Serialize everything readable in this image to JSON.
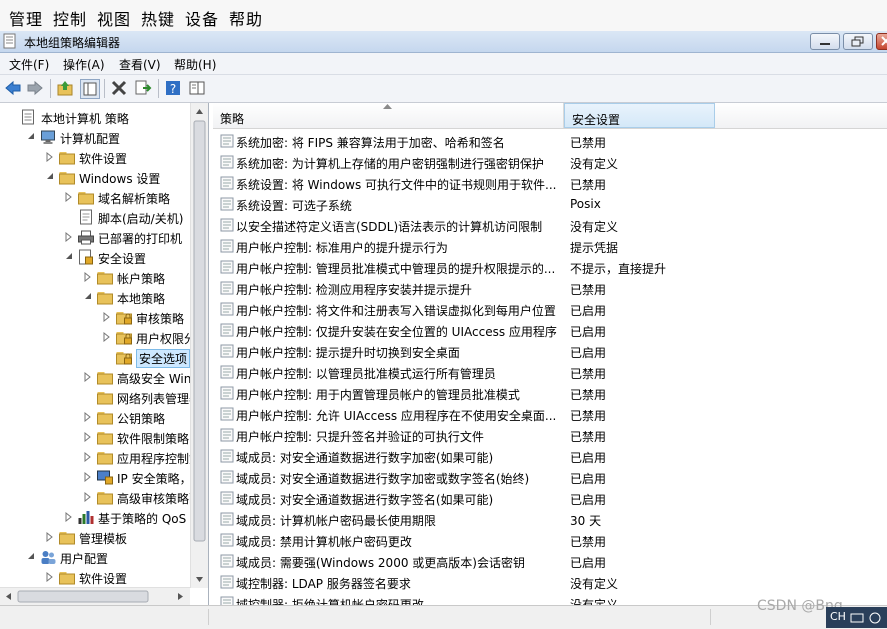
{
  "host_menu": [
    "管理",
    "控制",
    "视图",
    "热键",
    "设备",
    "帮助"
  ],
  "window": {
    "title": "本地组策略编辑器"
  },
  "menubar": [
    "文件(F)",
    "操作(A)",
    "查看(V)",
    "帮助(H)"
  ],
  "toolbar": [
    "back-arrow-icon",
    "forward-arrow-icon",
    "up-folder-icon",
    "show-hide-tree-icon",
    "delete-x-icon",
    "export-list-icon",
    "help-icon",
    "properties-pane-icon"
  ],
  "tree": [
    {
      "label": "本地计算机 策略",
      "icon": "computer-policy-icon",
      "expander": "none"
    },
    {
      "label": "计算机配置",
      "icon": "computer-icon",
      "expander": "expanded"
    },
    {
      "label": "软件设置",
      "icon": "folder-icon",
      "expander": "collapsed"
    },
    {
      "label": "Windows 设置",
      "icon": "folder-icon",
      "expander": "expanded"
    },
    {
      "label": "域名解析策略",
      "icon": "folder-icon",
      "expander": "collapsed"
    },
    {
      "label": "脚本(启动/关机)",
      "icon": "script-icon",
      "expander": "none"
    },
    {
      "label": "已部署的打印机",
      "icon": "printer-icon",
      "expander": "collapsed"
    },
    {
      "label": "安全设置",
      "icon": "security-icon",
      "expander": "expanded"
    },
    {
      "label": "帐户策略",
      "icon": "folder-icon",
      "expander": "collapsed"
    },
    {
      "label": "本地策略",
      "icon": "folder-icon",
      "expander": "expanded"
    },
    {
      "label": "审核策略",
      "icon": "lock-folder-icon",
      "expander": "collapsed"
    },
    {
      "label": "用户权限分配",
      "icon": "lock-folder-icon",
      "expander": "collapsed"
    },
    {
      "label": "安全选项",
      "icon": "lock-folder-icon",
      "expander": "none",
      "selected": true
    },
    {
      "label": "高级安全 Windo",
      "icon": "folder-icon",
      "expander": "collapsed"
    },
    {
      "label": "网络列表管理器策",
      "icon": "folder-icon",
      "expander": "none"
    },
    {
      "label": "公钥策略",
      "icon": "folder-icon",
      "expander": "collapsed"
    },
    {
      "label": "软件限制策略",
      "icon": "folder-icon",
      "expander": "collapsed"
    },
    {
      "label": "应用程序控制策略",
      "icon": "folder-icon",
      "expander": "collapsed"
    },
    {
      "label": "IP 安全策略，在",
      "icon": "ip-security-icon",
      "expander": "collapsed"
    },
    {
      "label": "高级审核策略配置",
      "icon": "folder-icon",
      "expander": "collapsed"
    },
    {
      "label": "基于策略的 QoS",
      "icon": "qos-chart-icon",
      "expander": "collapsed"
    },
    {
      "label": "管理模板",
      "icon": "folder-icon",
      "expander": "collapsed"
    },
    {
      "label": "用户配置",
      "icon": "users-icon",
      "expander": "expanded"
    },
    {
      "label": "软件设置",
      "icon": "folder-icon",
      "expander": "collapsed"
    }
  ],
  "list": {
    "columns": [
      "策略",
      "安全设置"
    ],
    "rows": [
      {
        "policy": "系统加密: 将 FIPS 兼容算法用于加密、哈希和签名",
        "value": "已禁用"
      },
      {
        "policy": "系统加密: 为计算机上存储的用户密钥强制进行强密钥保护",
        "value": "没有定义"
      },
      {
        "policy": "系统设置: 将 Windows 可执行文件中的证书规则用于软件...",
        "value": "已禁用"
      },
      {
        "policy": "系统设置: 可选子系统",
        "value": "Posix"
      },
      {
        "policy": "以安全描述符定义语言(SDDL)语法表示的计算机访问限制",
        "value": "没有定义"
      },
      {
        "policy": "用户帐户控制: 标准用户的提升提示行为",
        "value": "提示凭据"
      },
      {
        "policy": "用户帐户控制: 管理员批准模式中管理员的提升权限提示的...",
        "value": "不提示，直接提升"
      },
      {
        "policy": "用户帐户控制: 检测应用程序安装并提示提升",
        "value": "已禁用"
      },
      {
        "policy": "用户帐户控制: 将文件和注册表写入错误虚拟化到每用户位置",
        "value": "已启用"
      },
      {
        "policy": "用户帐户控制: 仅提升安装在安全位置的 UIAccess 应用程序",
        "value": "已启用"
      },
      {
        "policy": "用户帐户控制: 提示提升时切换到安全桌面",
        "value": "已启用"
      },
      {
        "policy": "用户帐户控制: 以管理员批准模式运行所有管理员",
        "value": "已禁用"
      },
      {
        "policy": "用户帐户控制: 用于内置管理员帐户的管理员批准模式",
        "value": "已禁用"
      },
      {
        "policy": "用户帐户控制: 允许 UIAccess 应用程序在不使用安全桌面...",
        "value": "已禁用"
      },
      {
        "policy": "用户帐户控制: 只提升签名并验证的可执行文件",
        "value": "已禁用"
      },
      {
        "policy": "域成员: 对安全通道数据进行数字加密(如果可能)",
        "value": "已启用"
      },
      {
        "policy": "域成员: 对安全通道数据进行数字加密或数字签名(始终)",
        "value": "已启用"
      },
      {
        "policy": "域成员: 对安全通道数据进行数字签名(如果可能)",
        "value": "已启用"
      },
      {
        "policy": "域成员: 计算机帐户密码最长使用期限",
        "value": "30 天"
      },
      {
        "policy": "域成员: 禁用计算机帐户密码更改",
        "value": "已禁用"
      },
      {
        "policy": "域成员: 需要强(Windows 2000 或更高版本)会话密钥",
        "value": "已启用"
      },
      {
        "policy": "域控制器: LDAP 服务器签名要求",
        "value": "没有定义"
      },
      {
        "policy": "域控制器: 拒绝计算机帐户密码更改",
        "value": "没有定义"
      }
    ]
  },
  "watermark": "CSDN @Bng",
  "tray": {
    "ime": "CH"
  },
  "colors": {
    "selection": "#cde8ff",
    "titlebar": "#c5d7ee",
    "folder": "#e8c25a",
    "lock": "#e0a828"
  }
}
